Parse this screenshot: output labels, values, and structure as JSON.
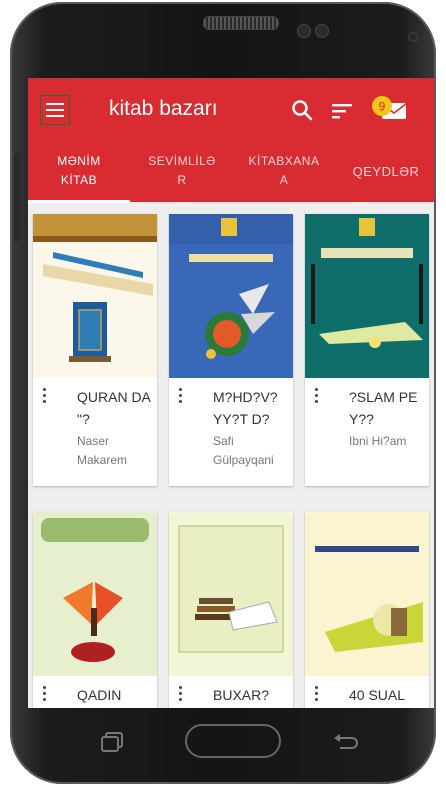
{
  "app": {
    "title": "kitab bazarı",
    "notification_count": "9"
  },
  "tabs": [
    {
      "label_l1": "MƏNİM",
      "label_l2": "KİTAB",
      "active": true
    },
    {
      "label_l1": "SEVİMLİLƏ",
      "label_l2": "R",
      "active": false
    },
    {
      "label_l1": "KİTABXANA",
      "label_l2": "A",
      "active": false
    },
    {
      "label_l1": "QEYDLƏR",
      "label_l2": "",
      "active": false
    }
  ],
  "books": [
    {
      "title": "QURAN DA \"?",
      "author": "Naser Makarem"
    },
    {
      "title": "M?HD?V? YY?T D?",
      "author": "Safi Gülpayqani"
    },
    {
      "title": "?SLAM PEY??",
      "author": "Ibni Hi?am"
    },
    {
      "title": "QADIN",
      "author": ""
    },
    {
      "title": "BUXAR?",
      "author": ""
    },
    {
      "title": "40 SUAL",
      "author": ""
    }
  ],
  "colors": {
    "accent": "#d92b32",
    "badge": "#f5c518"
  },
  "icons": {
    "menu": "hamburger-menu-icon",
    "search": "search-icon",
    "sort": "sort-icon",
    "notification": "mail-notification-icon",
    "recent_apps": "recent-apps-icon",
    "back": "back-arrow-icon"
  }
}
